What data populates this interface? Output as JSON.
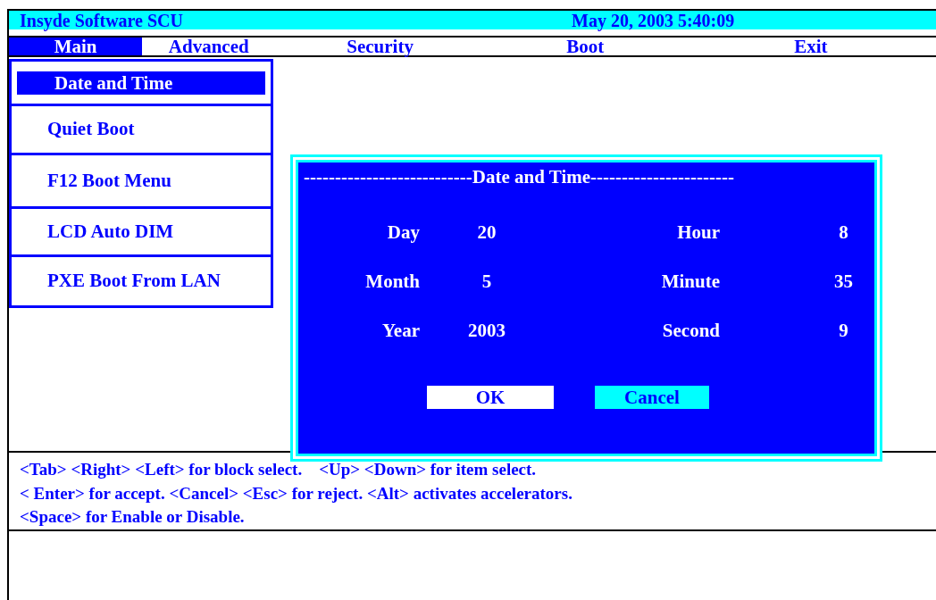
{
  "title_bar": {
    "title": "Insyde Software SCU",
    "datetime": "May 20, 2003 5:40:09"
  },
  "menu_tabs": [
    {
      "label": "Main",
      "selected": true
    },
    {
      "label": "Advanced",
      "selected": false
    },
    {
      "label": "Security",
      "selected": false
    },
    {
      "label": "Boot",
      "selected": false
    },
    {
      "label": "Exit",
      "selected": false
    }
  ],
  "sidebar": {
    "items": [
      {
        "label": "Date and Time",
        "selected": true
      },
      {
        "label": "Quiet Boot",
        "selected": false
      },
      {
        "label": "F12 Boot Menu",
        "selected": false
      },
      {
        "label": "LCD Auto DIM",
        "selected": false
      },
      {
        "label": "PXE Boot From LAN",
        "selected": false
      }
    ]
  },
  "dialog": {
    "title": "---------------------------Date and Time-----------------------",
    "left_fields": [
      {
        "label": "Day",
        "value": "20"
      },
      {
        "label": "Month",
        "value": "5"
      },
      {
        "label": "Year",
        "value": "2003"
      }
    ],
    "right_fields": [
      {
        "label": "Hour",
        "value": "8"
      },
      {
        "label": "Minute",
        "value": "35"
      },
      {
        "label": "Second",
        "value": "9"
      }
    ],
    "buttons": [
      {
        "label": "OK",
        "selected": true
      },
      {
        "label": "Cancel",
        "selected": false
      }
    ]
  },
  "help_lines": [
    "<Tab> <Right> <Left> for block select.    <Up> <Down> for item select.",
    "< Enter> for accept. <Cancel> <Esc> for reject. <Alt> activates accelerators.",
    "<Space> for Enable or Disable."
  ]
}
